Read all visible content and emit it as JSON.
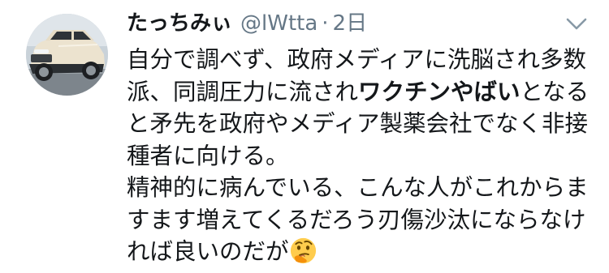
{
  "tweet": {
    "display_name": "たっちみぃ",
    "handle": "@lWtta",
    "separator": "·",
    "time": "2日",
    "lines": [
      {
        "pre": "自分で調べず、政府メディアに洗脳され多数",
        "bold": "",
        "post": ""
      },
      {
        "pre": "派、同調圧力に流され",
        "bold": "ワクチンやばい",
        "post": "となる"
      },
      {
        "pre": "と矛先を政府やメディア製薬会社でなく非接",
        "bold": "",
        "post": ""
      },
      {
        "pre": "種者に向ける。",
        "bold": "",
        "post": ""
      },
      {
        "pre": "精神的に病んでいる、こんな人がこれからま",
        "bold": "",
        "post": ""
      },
      {
        "pre": "すます増えてくるだろう刃傷沙汰にならなけ",
        "bold": "",
        "post": ""
      },
      {
        "pre": "れば良いのだが",
        "bold": "",
        "post": ""
      }
    ],
    "emoji_name": "thinking-face-emoji"
  },
  "icons": {
    "caret": "chevron-down-icon",
    "avatar": "suv-car-photo"
  },
  "colors": {
    "text": "#14171a",
    "secondary": "#657786",
    "background": "#ffffff",
    "emoji_face": "#ffcc4d"
  }
}
